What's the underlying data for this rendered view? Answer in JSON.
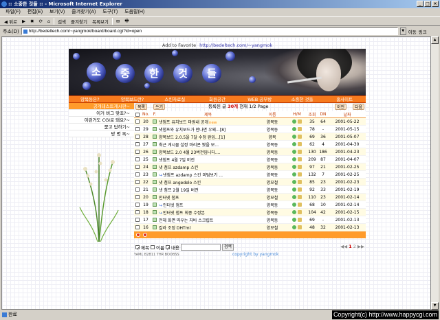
{
  "window": {
    "title": ":: 소중한 것들 :: - Microsoft Internet Explorer",
    "buttons": [
      "_",
      "□",
      "×"
    ]
  },
  "menu": [
    "파일(F)",
    "편집(E)",
    "보기(V)",
    "즐겨찾기(A)",
    "도구(T)",
    "도움말(H)"
  ],
  "toolbar": [
    "◀ 뒤로",
    "▶",
    "✖",
    "⟳",
    "⌂",
    "검색",
    "즐겨찾기",
    "목록보기",
    "✉",
    "🖶"
  ],
  "address": {
    "label": "주소(D)",
    "url": "http://bedeltech.com/~yangmok/board/board.cgi?id=open",
    "go": "이동",
    "links": "링크"
  },
  "status": {
    "text": "완료"
  },
  "watermark": "Copyright(c) http://www.happycgi.com",
  "page": {
    "fav": {
      "label": "Add to Favorite",
      "url": "http://bedeltech.com/~yangmok"
    },
    "banner_letters": [
      "소",
      "중",
      "한",
      "것",
      "들"
    ],
    "nav": [
      "양목동은?",
      "양목보드란?",
      "스킨자료실",
      "회원공간",
      "WEB 공부방",
      "소중한 것들",
      "홈사이트"
    ],
    "sidebar": [
      "공개테스트게시판~",
      "이거 버그 맞죠?~",
      "이런거도 CGI로 돼요?~",
      "묻고 답하기~",
      "방 명 록~"
    ],
    "controls": {
      "list": "목록",
      "write": "쓰기",
      "info": {
        "prefix": "등록된 글",
        "count": "30개",
        "middle": "현재",
        "page": "1/2 Page"
      },
      "prev": "이전",
      "next": "다음"
    },
    "columns": [
      "No.",
      "F.",
      "제목",
      "이름",
      "H/M",
      "조회",
      "DN",
      "날짜"
    ],
    "rows": [
      {
        "no": "30",
        "title": "냇첨프 유치보드 마원내 공개",
        "tag": "new",
        "name": "양목동",
        "views": "35",
        "dn": "64",
        "date": "2001-05-22"
      },
      {
        "no": "29",
        "title": "냇첨프와 유치보드가 만나면 우왜...[8]",
        "tag": "",
        "name": "양목동",
        "views": "78",
        "dn": "-",
        "date": "2001-05-15"
      },
      {
        "no": "28",
        "title": "양목보드 2.0.5을 7달 수정 완입...[1]",
        "tag": "",
        "name": "양목",
        "views": "69",
        "dn": "36",
        "date": "2001-05-07"
      },
      {
        "no": "27",
        "title": "최근 게시물 설정 마리콘 봤을 보...",
        "tag": "",
        "name": "양목동",
        "views": "62",
        "dn": "4",
        "date": "2001-04-30"
      },
      {
        "no": "26",
        "title": "양목보드 2.0 4월 23버전입니다....",
        "tag": "",
        "name": "양목동",
        "views": "130",
        "dn": "186",
        "date": "2001-04-23"
      },
      {
        "no": "25",
        "title": "냇첨프 4월 7일 버전",
        "tag": "",
        "name": "양목동",
        "views": "209",
        "dn": "87",
        "date": "2001-04-07"
      },
      {
        "no": "24",
        "title": "냇 첨프 azdamp 스킨",
        "tag": "",
        "name": "양목동",
        "views": "97",
        "dn": "21",
        "date": "2001-02-25"
      },
      {
        "no": "23",
        "title": "냇첨프 azdamp 스킨 미팀보기 ...",
        "tag": "",
        "name": "양목동",
        "views": "132",
        "dn": "7",
        "date": "2001-02-25",
        "reply": true
      },
      {
        "no": "22",
        "title": "냇 첨프 angedelo 스킨",
        "tag": "",
        "name": "양모철",
        "views": "85",
        "dn": "23",
        "date": "2001-02-23"
      },
      {
        "no": "21",
        "title": "냇 첨프 2월 19일 버전",
        "tag": "",
        "name": "양목동",
        "views": "92",
        "dn": "33",
        "date": "2001-02-19"
      },
      {
        "no": "20",
        "title": "인터넷 첨프",
        "tag": "",
        "name": "양모철",
        "views": "110",
        "dn": "23",
        "date": "2001-02-14"
      },
      {
        "no": "19",
        "title": "인터넷 첨프",
        "tag": "",
        "name": "양목동",
        "views": "68",
        "dn": "10",
        "date": "2001-02-14",
        "reply": true
      },
      {
        "no": "18",
        "title": "인터넷 첨프 최종 수정본",
        "tag": "",
        "name": "양목동",
        "views": "104",
        "dn": "42",
        "date": "2001-02-15",
        "reply": true
      },
      {
        "no": "17",
        "title": "전체 화면 띄우는 자바 스크립트",
        "tag": "",
        "name": "양목동",
        "views": "69",
        "dn": "-",
        "date": "2001-02-13"
      },
      {
        "no": "16",
        "title": "칼라 조정 DHTml",
        "tag": "",
        "name": "양모철",
        "views": "48",
        "dn": "32",
        "date": "2001-02-13"
      }
    ],
    "search": {
      "subject": "제목",
      "name": "이름",
      "content": "내용",
      "button": "검색"
    },
    "pager": {
      "arrows": "◀◀",
      "current": "1",
      "other": "2",
      "next": "▶▶"
    },
    "footer": {
      "powered": "YAML B2B11 THR BOOBSS",
      "copyright": "copyright by yangmok"
    }
  }
}
